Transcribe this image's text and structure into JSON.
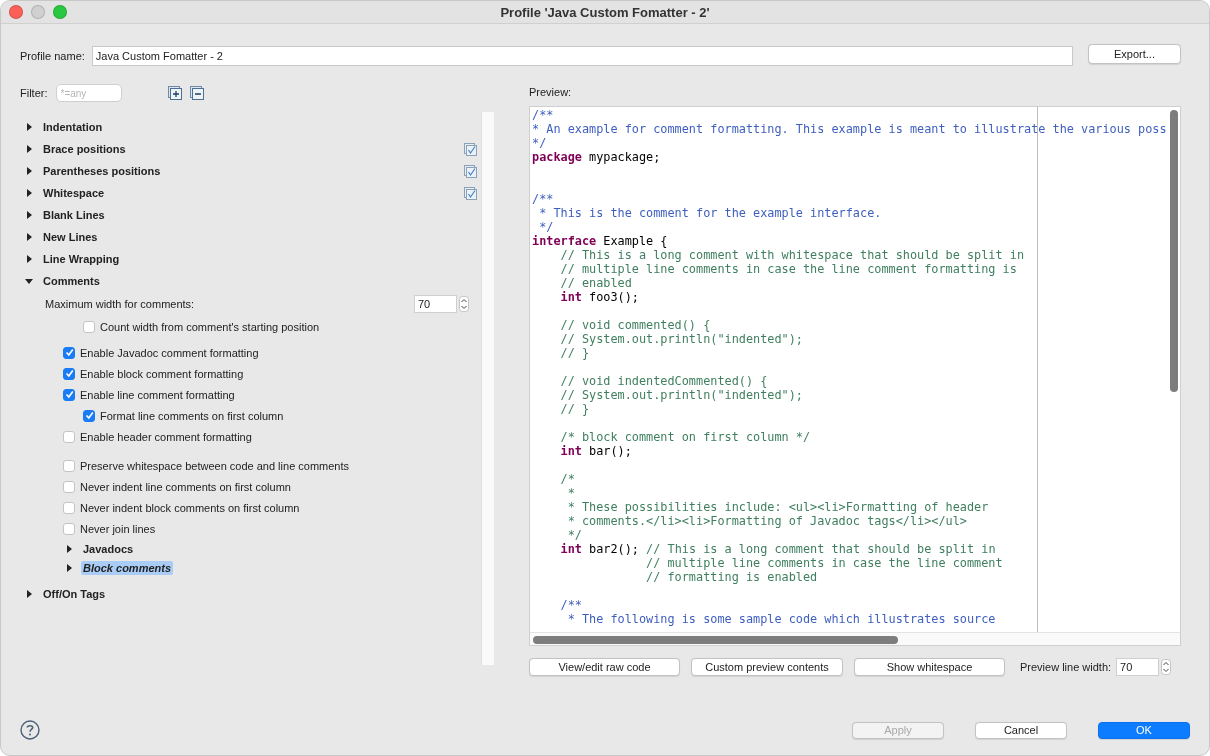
{
  "window": {
    "title": "Profile 'Java Custom Fomatter - 2'"
  },
  "profile": {
    "label": "Profile name:",
    "value": "Java Custom Fomatter - 2",
    "export_button": "Export..."
  },
  "filter": {
    "label": "Filter:",
    "placeholder": "*=any"
  },
  "tree": [
    {
      "label": "Indentation",
      "expanded": false,
      "checked": false
    },
    {
      "label": "Brace positions",
      "expanded": false,
      "checked": true
    },
    {
      "label": "Parentheses positions",
      "expanded": false,
      "checked": true
    },
    {
      "label": "Whitespace",
      "expanded": false,
      "checked": true
    },
    {
      "label": "Blank Lines",
      "expanded": false,
      "checked": false
    },
    {
      "label": "New Lines",
      "expanded": false,
      "checked": false
    },
    {
      "label": "Line Wrapping",
      "expanded": false,
      "checked": false
    },
    {
      "label": "Comments",
      "expanded": true,
      "checked": false,
      "groups": [
        [
          {
            "kind": "number",
            "label": "Maximum width for comments:",
            "value": "70",
            "children": [
              {
                "kind": "checkbox",
                "label": "Count width from comment's starting position",
                "checked": false
              }
            ]
          }
        ],
        [
          {
            "kind": "checkbox",
            "label": "Enable Javadoc comment formatting",
            "checked": true
          },
          {
            "kind": "checkbox",
            "label": "Enable block comment formatting",
            "checked": true
          },
          {
            "kind": "checkbox",
            "label": "Enable line comment formatting",
            "checked": true,
            "children": [
              {
                "kind": "checkbox",
                "label": "Format line comments on first column",
                "checked": true
              }
            ]
          },
          {
            "kind": "checkbox",
            "label": "Enable header comment formatting",
            "checked": false
          }
        ],
        [
          {
            "kind": "checkbox",
            "label": "Preserve whitespace between code and line comments",
            "checked": false
          },
          {
            "kind": "checkbox",
            "label": "Never indent line comments on first column",
            "checked": false
          },
          {
            "kind": "checkbox",
            "label": "Never indent block comments on first column",
            "checked": false
          },
          {
            "kind": "checkbox",
            "label": "Never join lines",
            "checked": false
          },
          {
            "kind": "section",
            "label": "Javadocs",
            "expanded": false,
            "selected": false
          },
          {
            "kind": "section",
            "label": "Block comments",
            "expanded": false,
            "selected": true
          }
        ]
      ]
    },
    {
      "label": "Off/On Tags",
      "expanded": false,
      "checked": false
    }
  ],
  "preview": {
    "label": "Preview:",
    "lines": [
      {
        "kind": "code",
        "spans": [
          {
            "kind": "doc",
            "text": "/**"
          }
        ]
      },
      {
        "kind": "code",
        "spans": [
          {
            "kind": "doc",
            "text": "* An example for comment formatting. This example is meant to illustrate the various poss"
          }
        ]
      },
      {
        "kind": "code",
        "spans": [
          {
            "kind": "doc",
            "text": "*/"
          }
        ]
      },
      {
        "kind": "code",
        "spans": [
          {
            "kind": "keyword",
            "text": "package"
          },
          {
            "kind": "plain",
            "text": " mypackage;"
          }
        ]
      },
      {
        "kind": "blank"
      },
      {
        "kind": "blank"
      },
      {
        "kind": "code",
        "spans": [
          {
            "kind": "doc",
            "text": "/**"
          }
        ]
      },
      {
        "kind": "code",
        "spans": [
          {
            "kind": "doc",
            "text": " * This is the comment for the example interface."
          }
        ]
      },
      {
        "kind": "code",
        "spans": [
          {
            "kind": "doc",
            "text": " */"
          }
        ]
      },
      {
        "kind": "code",
        "spans": [
          {
            "kind": "keyword",
            "text": "interface"
          },
          {
            "kind": "plain",
            "text": " Example {"
          }
        ]
      },
      {
        "kind": "code",
        "spans": [
          {
            "kind": "comment",
            "text": "    // This is a long comment with whitespace that should be split in"
          }
        ]
      },
      {
        "kind": "code",
        "spans": [
          {
            "kind": "comment",
            "text": "    // multiple line comments in case the line comment formatting is"
          }
        ]
      },
      {
        "kind": "code",
        "spans": [
          {
            "kind": "comment",
            "text": "    // enabled"
          }
        ]
      },
      {
        "kind": "code",
        "spans": [
          {
            "kind": "keyword",
            "text": "    int"
          },
          {
            "kind": "plain",
            "text": " foo3();"
          }
        ]
      },
      {
        "kind": "blank"
      },
      {
        "kind": "code",
        "spans": [
          {
            "kind": "comment",
            "text": "    // void commented() {"
          }
        ]
      },
      {
        "kind": "code",
        "spans": [
          {
            "kind": "comment",
            "text": "    // System.out.println(\"indented\");"
          }
        ]
      },
      {
        "kind": "code",
        "spans": [
          {
            "kind": "comment",
            "text": "    // }"
          }
        ]
      },
      {
        "kind": "blank"
      },
      {
        "kind": "code",
        "spans": [
          {
            "kind": "comment",
            "text": "    // void indentedCommented() {"
          }
        ]
      },
      {
        "kind": "code",
        "spans": [
          {
            "kind": "comment",
            "text": "    // System.out.println(\"indented\");"
          }
        ]
      },
      {
        "kind": "code",
        "spans": [
          {
            "kind": "comment",
            "text": "    // }"
          }
        ]
      },
      {
        "kind": "blank"
      },
      {
        "kind": "code",
        "spans": [
          {
            "kind": "comment",
            "text": "    /* block comment on first column */"
          }
        ]
      },
      {
        "kind": "code",
        "spans": [
          {
            "kind": "keyword",
            "text": "    int"
          },
          {
            "kind": "plain",
            "text": " bar();"
          }
        ]
      },
      {
        "kind": "blank"
      },
      {
        "kind": "code",
        "spans": [
          {
            "kind": "comment",
            "text": "    /*"
          }
        ]
      },
      {
        "kind": "code",
        "spans": [
          {
            "kind": "comment",
            "text": "     *"
          }
        ]
      },
      {
        "kind": "code",
        "spans": [
          {
            "kind": "comment",
            "text": "     * These possibilities include: <ul><li>Formatting of header"
          }
        ]
      },
      {
        "kind": "code",
        "spans": [
          {
            "kind": "comment",
            "text": "     * comments.</li><li>Formatting of Javadoc tags</li></ul>"
          }
        ]
      },
      {
        "kind": "code",
        "spans": [
          {
            "kind": "comment",
            "text": "     */"
          }
        ]
      },
      {
        "kind": "code",
        "spans": [
          {
            "kind": "keyword",
            "text": "    int"
          },
          {
            "kind": "plain",
            "text": " bar2(); "
          },
          {
            "kind": "comment",
            "text": "// This is a long comment that should be split in"
          }
        ]
      },
      {
        "kind": "code",
        "spans": [
          {
            "kind": "comment",
            "text": "                // multiple line comments in case the line comment"
          }
        ]
      },
      {
        "kind": "code",
        "spans": [
          {
            "kind": "comment",
            "text": "                // formatting is enabled"
          }
        ]
      },
      {
        "kind": "blank"
      },
      {
        "kind": "code",
        "spans": [
          {
            "kind": "doc",
            "text": "    /**"
          }
        ]
      },
      {
        "kind": "code",
        "spans": [
          {
            "kind": "doc",
            "text": "     * The following is some sample code which illustrates source"
          }
        ]
      }
    ],
    "buttons": [
      "View/edit raw code",
      "Custom preview contents",
      "Show whitespace"
    ],
    "line_width": {
      "label": "Preview line width:",
      "value": "70"
    }
  },
  "footer": {
    "buttons": [
      {
        "label": "Apply",
        "kind": "default",
        "disabled": true
      },
      {
        "label": "Cancel",
        "kind": "default",
        "disabled": false
      },
      {
        "label": "OK",
        "kind": "primary",
        "disabled": false
      }
    ]
  }
}
